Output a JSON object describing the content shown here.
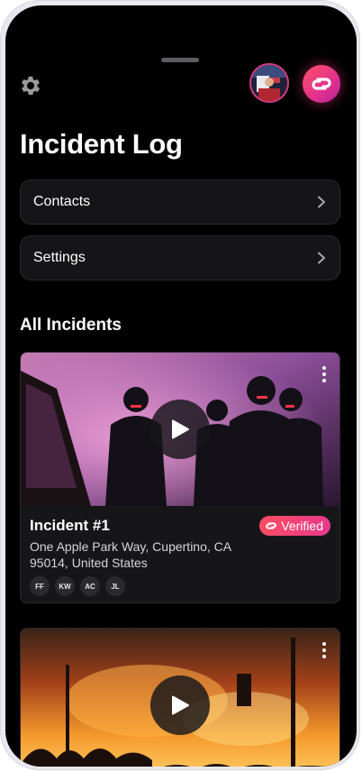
{
  "header": {
    "settings_icon": "gear-icon",
    "profile_avatar_icon": "user-photo",
    "app_logo_icon": "link-logo-icon",
    "accent_color": "#e8358b"
  },
  "page": {
    "title": "Incident Log"
  },
  "menu": {
    "items": [
      {
        "label": "Contacts",
        "icon": "chevron-right-icon"
      },
      {
        "label": "Settings",
        "icon": "chevron-right-icon"
      }
    ]
  },
  "incidents": {
    "section_title": "All Incidents",
    "items": [
      {
        "title": "Incident #1",
        "badge": "Verified",
        "address_line1": "One Apple Park Way, Cupertino, CA",
        "address_line2": "95014, United States",
        "participants": [
          "FF",
          "KW",
          "AC",
          "JL"
        ]
      },
      {
        "title": "",
        "badge": ""
      }
    ]
  }
}
